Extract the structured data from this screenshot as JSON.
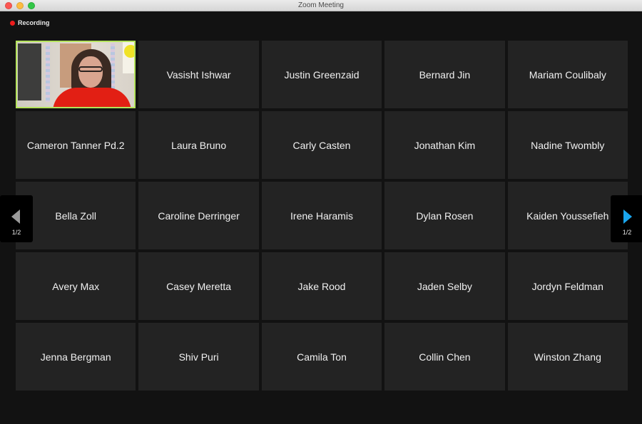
{
  "window": {
    "title": "Zoom Meeting"
  },
  "recording": {
    "label": "Recording",
    "indicator_color": "#ee1c1c"
  },
  "self_view": {
    "type": "video",
    "active_speaker_border_color": "#b4e35c"
  },
  "participants": [
    "Vasisht Ishwar",
    "Justin Greenzaid",
    "Bernard Jin",
    "Mariam Coulibaly",
    "Cameron Tanner Pd.2",
    "Laura Bruno",
    "Carly Casten",
    "Jonathan Kim",
    "Nadine Twombly",
    "Bella Zoll",
    "Caroline Derringer",
    "Irene Haramis",
    "Dylan Rosen",
    "Kaiden Youssefieh",
    "Avery Max",
    "Casey Meretta",
    "Jake Rood",
    "Jaden Selby",
    "Jordyn Feldman",
    "Jenna Bergman",
    "Shiv Puri",
    "Camila Ton",
    "Collin Chen",
    "Winston Zhang"
  ],
  "pagination": {
    "prev": {
      "icon": "triangle-left-icon",
      "label": "1/2",
      "enabled": false
    },
    "next": {
      "icon": "triangle-right-icon",
      "label": "1/2",
      "enabled": true,
      "color": "#1aa6ee"
    }
  }
}
